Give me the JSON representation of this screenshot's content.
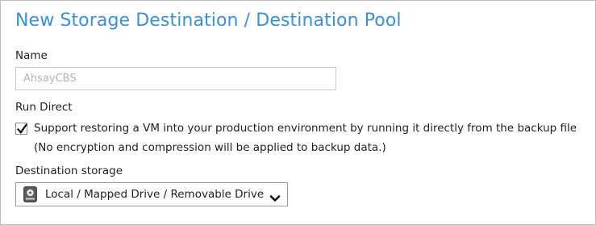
{
  "header": {
    "title": "New Storage Destination / Destination Pool"
  },
  "form": {
    "name_label": "Name",
    "name_value": "AhsayCBS",
    "run_direct_label": "Run Direct",
    "run_direct_checkbox_label": "Support restoring a VM into your production environment by running it directly from the backup file",
    "run_direct_checked": true,
    "run_direct_note": "(No encryption and compression will be applied to backup data.)",
    "destination_storage_label": "Destination storage",
    "destination_storage_selected": "Local / Mapped Drive / Removable Drive",
    "destination_storage_icon": "local-drive-icon"
  },
  "colors": {
    "title": "#3d8fd6",
    "disabled_text": "#b3b3b3"
  }
}
